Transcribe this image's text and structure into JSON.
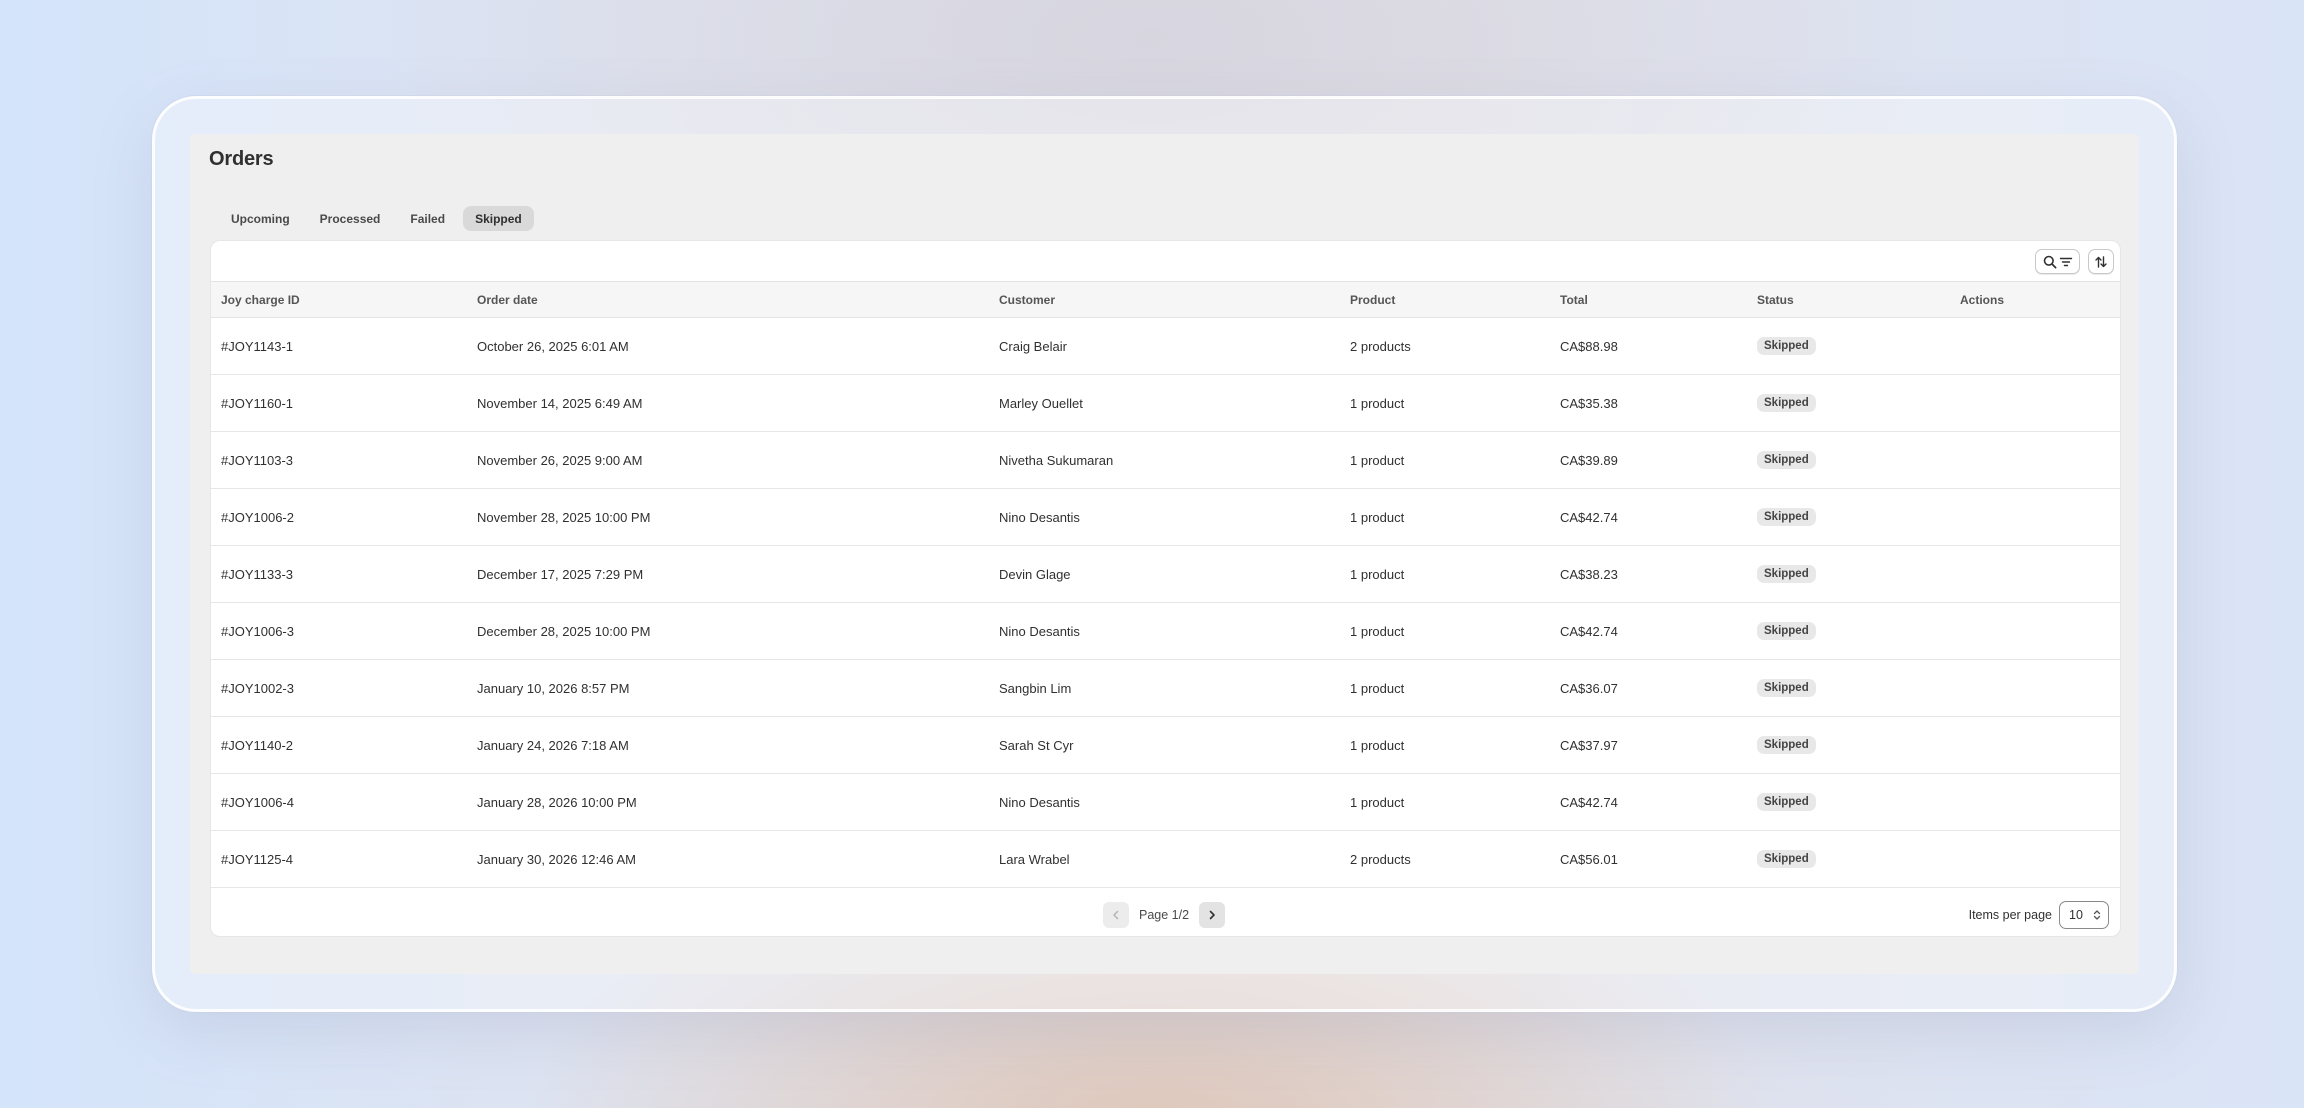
{
  "page": {
    "title": "Orders"
  },
  "tabs": [
    {
      "label": "Upcoming",
      "active": false
    },
    {
      "label": "Processed",
      "active": false
    },
    {
      "label": "Failed",
      "active": false
    },
    {
      "label": "Skipped",
      "active": true
    }
  ],
  "table": {
    "columns": [
      "Joy charge ID",
      "Order date",
      "Customer",
      "Product",
      "Total",
      "Status",
      "Actions"
    ],
    "rows": [
      {
        "id": "#JOY1143-1",
        "date": "October 26, 2025 6:01 AM",
        "customer": "Craig Belair",
        "product": "2 products",
        "total": "CA$88.98",
        "status": "Skipped"
      },
      {
        "id": "#JOY1160-1",
        "date": "November 14, 2025 6:49 AM",
        "customer": "Marley Ouellet",
        "product": "1 product",
        "total": "CA$35.38",
        "status": "Skipped"
      },
      {
        "id": "#JOY1103-3",
        "date": "November 26, 2025 9:00 AM",
        "customer": "Nivetha Sukumaran",
        "product": "1 product",
        "total": "CA$39.89",
        "status": "Skipped"
      },
      {
        "id": "#JOY1006-2",
        "date": "November 28, 2025 10:00 PM",
        "customer": "Nino Desantis",
        "product": "1 product",
        "total": "CA$42.74",
        "status": "Skipped"
      },
      {
        "id": "#JOY1133-3",
        "date": "December 17, 2025 7:29 PM",
        "customer": "Devin Glage",
        "product": "1 product",
        "total": "CA$38.23",
        "status": "Skipped"
      },
      {
        "id": "#JOY1006-3",
        "date": "December 28, 2025 10:00 PM",
        "customer": "Nino Desantis",
        "product": "1 product",
        "total": "CA$42.74",
        "status": "Skipped"
      },
      {
        "id": "#JOY1002-3",
        "date": "January 10, 2026 8:57 PM",
        "customer": "Sangbin Lim",
        "product": "1 product",
        "total": "CA$36.07",
        "status": "Skipped"
      },
      {
        "id": "#JOY1140-2",
        "date": "January 24, 2026 7:18 AM",
        "customer": "Sarah St Cyr",
        "product": "1 product",
        "total": "CA$37.97",
        "status": "Skipped"
      },
      {
        "id": "#JOY1006-4",
        "date": "January 28, 2026 10:00 PM",
        "customer": "Nino Desantis",
        "product": "1 product",
        "total": "CA$42.74",
        "status": "Skipped"
      },
      {
        "id": "#JOY1125-4",
        "date": "January 30, 2026 12:46 AM",
        "customer": "Lara Wrabel",
        "product": "2 products",
        "total": "CA$56.01",
        "status": "Skipped"
      }
    ]
  },
  "toolbar": {
    "search_filter_icons": [
      "search-icon",
      "filter-icon"
    ],
    "sort_icon": "sort-icon"
  },
  "pagination": {
    "page_text": "Page 1/2",
    "prev_icon": "chevron-left-icon",
    "next_icon": "chevron-right-icon",
    "prev_disabled": true
  },
  "items_per_page": {
    "label": "Items per page",
    "value": "10"
  }
}
